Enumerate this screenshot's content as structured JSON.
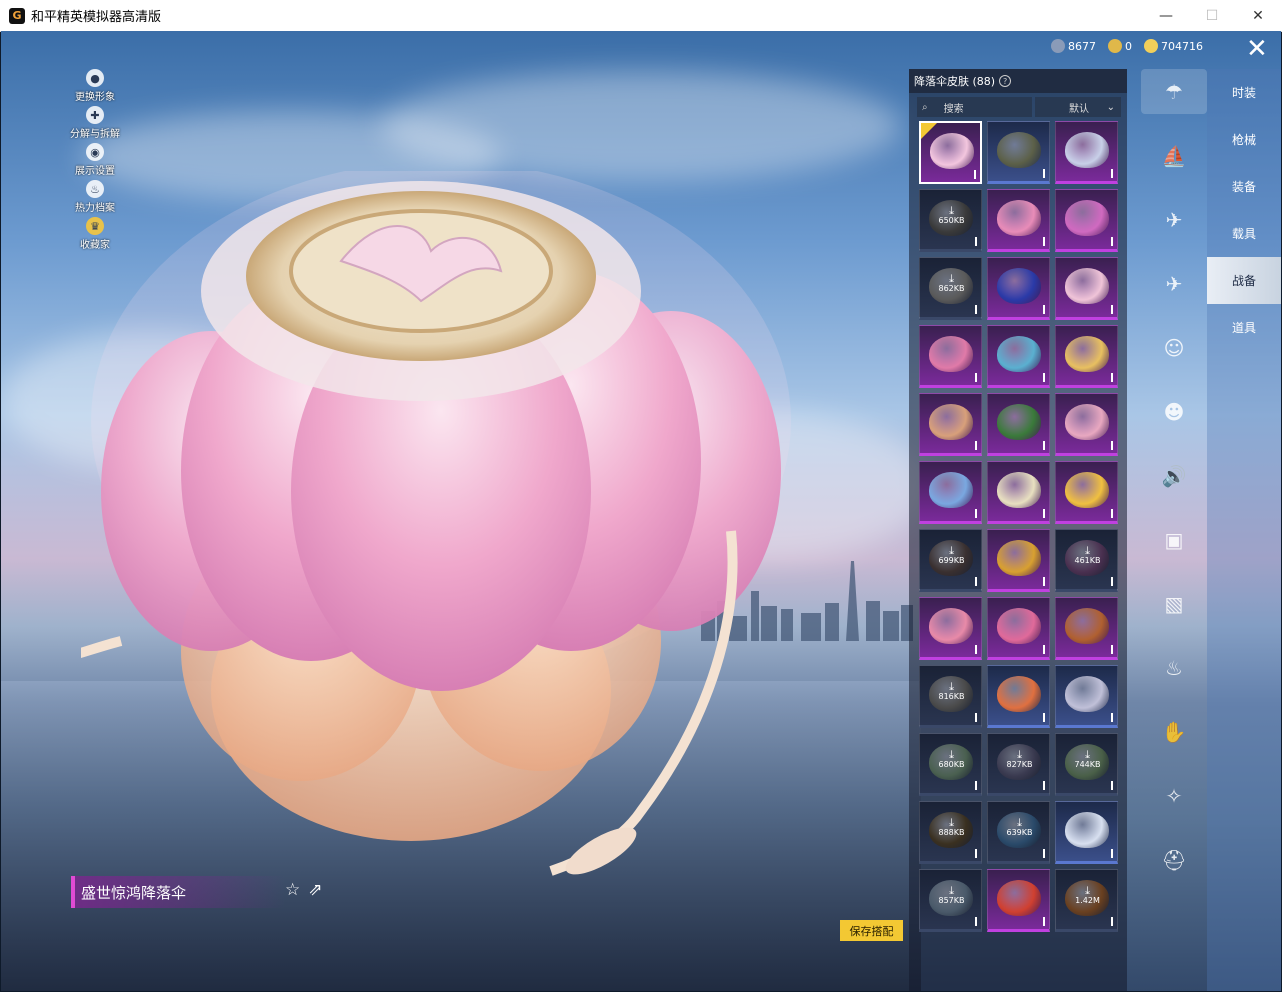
{
  "window": {
    "title": "和平精英模拟器高清版",
    "app_icon_letter": "G",
    "controls": {
      "minimize": "—",
      "maximize": "☐",
      "close": "✕"
    }
  },
  "left_tools": [
    {
      "label": "更换形象",
      "icon": "person-icon"
    },
    {
      "label": "分解与拆解",
      "icon": "puzzle-icon"
    },
    {
      "label": "展示设置",
      "icon": "eye-icon"
    },
    {
      "label": "热力档案",
      "icon": "flame-icon"
    },
    {
      "label": "收藏家",
      "icon": "collector-badge-icon"
    }
  ],
  "currency": [
    {
      "value": "8677",
      "color": "#8a9bb8"
    },
    {
      "value": "0",
      "color": "#e0b84a"
    },
    {
      "value": "704716",
      "color": "#f2cf5a"
    }
  ],
  "item_name": "盛世惊鸿降落伞",
  "save_label": "保存搭配",
  "panel": {
    "title": "降落伞皮肤 (88)",
    "help": "?",
    "search_placeholder": "搜索",
    "sort": "默认"
  },
  "grid": [
    {
      "rarity": "purple",
      "color": "#f3c6de",
      "selected": true
    },
    {
      "rarity": "blue",
      "color": "#5c6048"
    },
    {
      "rarity": "purple",
      "color": "#c8d0e8"
    },
    {
      "rarity": "dark",
      "color": "#3a3a3a",
      "download": "650KB"
    },
    {
      "rarity": "purple",
      "color": "#e88cb8"
    },
    {
      "rarity": "purple",
      "color": "#d06ac0"
    },
    {
      "rarity": "dark",
      "color": "#5a5a5a",
      "download": "862KB"
    },
    {
      "rarity": "purple",
      "color": "#2a3aa8"
    },
    {
      "rarity": "purple",
      "color": "#f0c4d8"
    },
    {
      "rarity": "purple",
      "color": "#e07aa8"
    },
    {
      "rarity": "purple",
      "color": "#5ab0d0"
    },
    {
      "rarity": "purple",
      "color": "#e8c060"
    },
    {
      "rarity": "purple",
      "color": "#d8a07a"
    },
    {
      "rarity": "purple",
      "color": "#3a7a3a"
    },
    {
      "rarity": "purple",
      "color": "#e8a8c0"
    },
    {
      "rarity": "purple",
      "color": "#7aa8e0"
    },
    {
      "rarity": "purple",
      "color": "#e8e0c0"
    },
    {
      "rarity": "purple",
      "color": "#f0c040"
    },
    {
      "rarity": "dark",
      "color": "#3a3030",
      "download": "699KB"
    },
    {
      "rarity": "purple",
      "color": "#d8a030"
    },
    {
      "rarity": "dark",
      "color": "#4a3050",
      "download": "461KB"
    },
    {
      "rarity": "purple",
      "color": "#e88aa8"
    },
    {
      "rarity": "purple",
      "color": "#e06a9a"
    },
    {
      "rarity": "purple",
      "color": "#b06030"
    },
    {
      "rarity": "dark",
      "color": "#4a4a4a",
      "download": "816KB"
    },
    {
      "rarity": "blue",
      "color": "#e07040"
    },
    {
      "rarity": "blue",
      "color": "#c0c0d8"
    },
    {
      "rarity": "dark",
      "color": "#4a6050",
      "download": "680KB"
    },
    {
      "rarity": "dark",
      "color": "#3a3a50",
      "download": "827KB"
    },
    {
      "rarity": "dark",
      "color": "#4a6048",
      "download": "744KB"
    },
    {
      "rarity": "dark",
      "color": "#3a3020",
      "download": "888KB"
    },
    {
      "rarity": "dark",
      "color": "#2a4a6a",
      "download": "639KB"
    },
    {
      "rarity": "blue",
      "color": "#d8e0f0"
    },
    {
      "rarity": "dark",
      "color": "#4a5a6a",
      "download": "857KB"
    },
    {
      "rarity": "purple",
      "color": "#d04030"
    },
    {
      "rarity": "dark",
      "color": "#6a4020",
      "download": "1.42M"
    }
  ],
  "category_icons": [
    "parachute-icon",
    "glider-icon",
    "drone-icon",
    "plane-icon",
    "emote-icon",
    "robot-icon",
    "voice-icon",
    "badge-icon",
    "photo-icon",
    "extinguisher-icon",
    "hand-icon",
    "sparkle-icon",
    "helmet-icon"
  ],
  "category_glyphs": [
    "☂",
    "⛵",
    "✈",
    "✈",
    "☺",
    "☻",
    "🔊",
    "▣",
    "▧",
    "♨",
    "✋",
    "✧",
    "⛑"
  ],
  "tabs": [
    {
      "label": "时装",
      "active": false
    },
    {
      "label": "枪械",
      "active": false
    },
    {
      "label": "装备",
      "active": false
    },
    {
      "label": "载具",
      "active": false
    },
    {
      "label": "战备",
      "active": true
    },
    {
      "label": "道具",
      "active": false
    }
  ],
  "close_glyph": "✕"
}
